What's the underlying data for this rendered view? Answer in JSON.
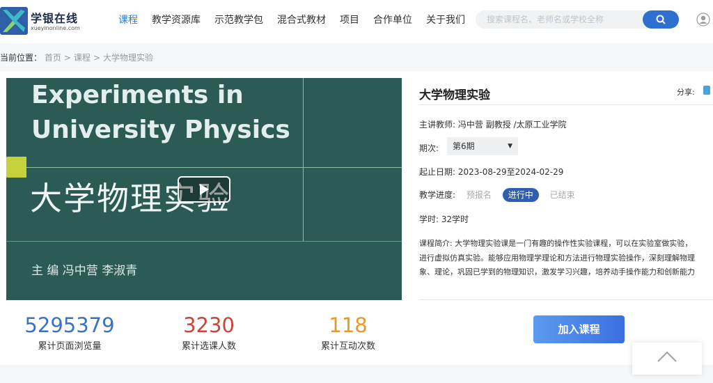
{
  "header": {
    "logo_name": "学银在线",
    "logo_domain": "xueyinonline.com",
    "nav": [
      "课程",
      "教学资源库",
      "示范教学包",
      "混合式教材",
      "项目",
      "合作单位",
      "关于我们"
    ],
    "active_nav": "课程",
    "search_placeholder": "搜索课程名、老师名或学校全称"
  },
  "breadcrumb": {
    "prefix": "当前位置：",
    "home": "首页",
    "sep": ">",
    "section": "课程",
    "current": "大学物理实验"
  },
  "cover": {
    "title_en_1": "Experiments in",
    "title_en_2": "University Physics",
    "title_cn": "大学物理实验",
    "editors": "主  编  冯中营   李淑青"
  },
  "stats": [
    {
      "value": "5295379",
      "label": "累计页面浏览量",
      "color": "#3b73c4"
    },
    {
      "value": "3230",
      "label": "累计选课人数",
      "color": "#c9463b"
    },
    {
      "value": "118",
      "label": "累计互动次数",
      "color": "#e39a33"
    }
  ],
  "course": {
    "title": "大学物理实验",
    "share_label": "分享:",
    "teacher_label": "主讲教师:",
    "teacher": "冯中营 副教授 /太原工业学院",
    "period_label": "期次:",
    "period_value": "第6期",
    "date_label": "起止日期:",
    "date_value": "2023-08-29至2024-02-29",
    "progress_label": "教学进度:",
    "progress_states": [
      "预报名",
      "进行中",
      "已结束"
    ],
    "progress_current": "进行中",
    "hours_label": "学时:",
    "hours_value": "32学时",
    "intro_label": "课程简介:",
    "intro_line1": "大学物理实验课是一门有趣的操作性实验课程，可以在实验室做实验，",
    "intro_line2": "进行虚拟仿真实验。能够应用物理学理论和方法进行物理实验操作，深刻理解物理",
    "intro_line3": "象、理论，巩固已学到的物理知识，激发学习兴趣，培养动手操作能力和创新能力"
  },
  "join_button": "加入课程",
  "colors": {
    "accent": "#2a7fd9",
    "button": "#2e6fd0"
  }
}
